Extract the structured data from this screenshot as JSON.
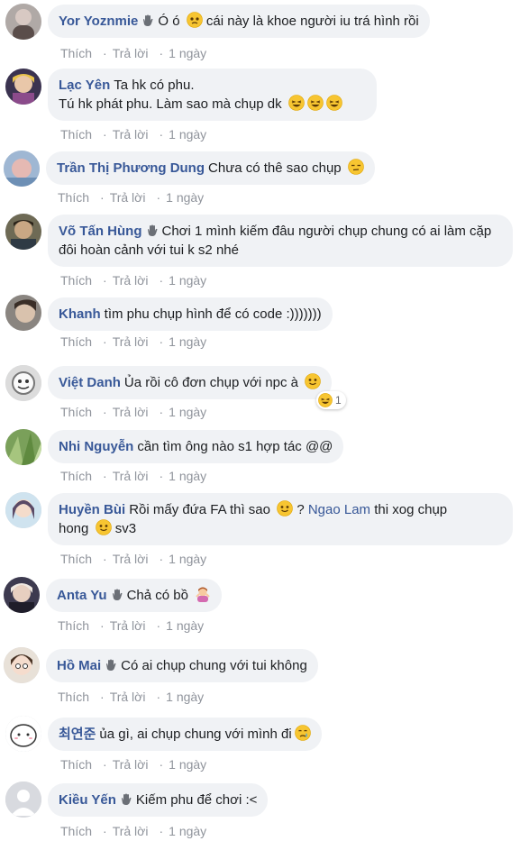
{
  "actions": {
    "like": "Thích",
    "reply": "Trả lời",
    "time": "1 ngày",
    "sep": "·"
  },
  "comments": [
    {
      "name": "Yor Yoznmie",
      "text": "Ó ó",
      "text2": "cái này là khoe người iu trá hình rồi"
    },
    {
      "name": "Lạc Yên",
      "line1": "Ta hk có phu.",
      "line2": "Tú hk phát phu. Làm sao mà chụp dk"
    },
    {
      "name": "Trần Thị Phương Dung",
      "text": "Chưa có thê sao chụp"
    },
    {
      "name": "Võ Tấn Hùng",
      "text": "Chơi 1 mình kiếm đâu người chụp chung có ai làm cặp đôi hoàn cảnh với tui k s2 nhé"
    },
    {
      "name": "Khanh",
      "text": "tìm phu chụp hình để có code :)))))))"
    },
    {
      "name": "Việt Danh",
      "text": "Ủa rồi cô đơn chụp với npc à",
      "reaction_count": "1"
    },
    {
      "name": "Nhi Nguyễn",
      "text": "cần tìm ông nào s1 hợp tác @@"
    },
    {
      "name": "Huyền Bùi",
      "text": "Rồi mấy đứa FA thì sao",
      "text_b": "?",
      "mention": "Ngao Lam",
      "text_c": "thi xog chụp",
      "line2": "hong",
      "text_d": "sv3"
    },
    {
      "name": "Anta Yu",
      "text": "Chả có bồ"
    },
    {
      "name": "Hồ Mai",
      "text": "Có ai chụp chung với tui không"
    },
    {
      "name": "최연준",
      "text": "ủa gì, ai chụp chung với mình đi"
    },
    {
      "name": "Kiều Yến",
      "text": "Kiếm phu để chơi :<"
    }
  ],
  "icons": {
    "badge": "top-fan-wave-icon",
    "emoji_cry": "sad-face-emoji",
    "emoji_laugh": "laughing-emoji",
    "emoji_meh": "unamused-emoji",
    "emoji_smile": "smile-emoji",
    "emoji_shrug": "person-gesturing-emoji",
    "emoji_tear": "crying-emoji"
  },
  "colors": {
    "name": "#385898",
    "bubble": "#f0f2f5",
    "meta": "#90949c"
  }
}
